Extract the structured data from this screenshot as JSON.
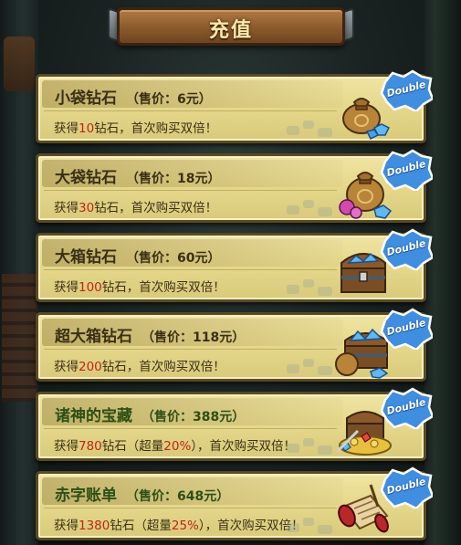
{
  "header": {
    "title": "充值"
  },
  "badge_label": "Double",
  "items": [
    {
      "name": "小袋钻石",
      "price": "（售价：6元）",
      "desc_prefix": "获得",
      "amount": "10",
      "desc_suffix": "钻石，首次购买双倍！",
      "icon": "small-diamond-bag-icon"
    },
    {
      "name": "大袋钻石",
      "price": "（售价：18元）",
      "desc_prefix": "获得",
      "amount": "30",
      "desc_suffix": "钻石，首次购买双倍！",
      "icon": "large-diamond-bag-icon"
    },
    {
      "name": "大箱钻石",
      "price": "（售价：60元）",
      "desc_prefix": "获得",
      "amount": "100",
      "desc_suffix": "钻石，首次购买双倍！",
      "icon": "diamond-chest-icon"
    },
    {
      "name": "超大箱钻石",
      "price": "（售价：118元）",
      "desc_prefix": "获得",
      "amount": "200",
      "desc_suffix": "钻石，首次购买双倍！",
      "icon": "huge-diamond-chest-icon"
    },
    {
      "name": "诸神的宝藏",
      "price": "（售价：388元）",
      "desc_prefix": "获得",
      "amount": "780",
      "desc_middle": "钻石（超量",
      "bonus": "20%",
      "desc_suffix": "），首次购买双倍！",
      "icon": "treasure-pile-icon"
    },
    {
      "name": "赤字账单",
      "price": "（售价：648元）",
      "desc_prefix": "获得",
      "amount": "1380",
      "desc_middle": "钻石（超量",
      "bonus": "25%",
      "desc_suffix": "），首次购买双倍！",
      "icon": "scroll-bill-icon"
    }
  ],
  "colors": {
    "card_bg": "#e6d98d",
    "highlight_red": "#c02418",
    "badge_blue": "#3f8ee0",
    "green_title": "#2c4f14"
  }
}
